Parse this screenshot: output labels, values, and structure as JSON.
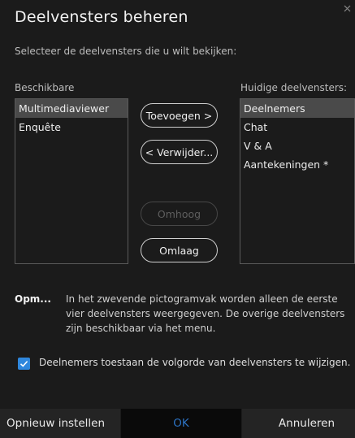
{
  "dialog": {
    "title": "Deelvensters beheren",
    "subtitle": "Selecteer de deelvensters die u wilt bekijken:"
  },
  "available": {
    "label": "Beschikbare",
    "items": [
      "Multimediaviewer",
      "Enquête"
    ],
    "selected_index": 0
  },
  "current": {
    "label": "Huidige deelvensters:",
    "items": [
      "Deelnemers",
      "Chat",
      "V & A",
      "Aantekeningen *"
    ],
    "selected_index": 0
  },
  "buttons": {
    "add": "Toevoegen >",
    "remove": "< Verwijder...",
    "up": "Omhoog",
    "down": "Omlaag"
  },
  "note": {
    "label": "Opm...",
    "text": "In het zwevende pictogramvak worden alleen de eerste vier deelvensters weergegeven. De overige deelvensters zijn beschikbaar via het menu."
  },
  "option": {
    "label": "Deelnemers toestaan de volgorde van deelvensters te wijzigen.",
    "checked": true
  },
  "footer": {
    "reset": "Opnieuw instellen",
    "ok": "OK",
    "cancel": "Annuleren"
  },
  "colors": {
    "background": "#1b1b1b",
    "accent": "#2f87dd",
    "ok_text": "#2c72c2",
    "selection": "#4a4a4a"
  },
  "icons": {
    "checkbox": "checkmark-icon",
    "close": "close-icon"
  }
}
